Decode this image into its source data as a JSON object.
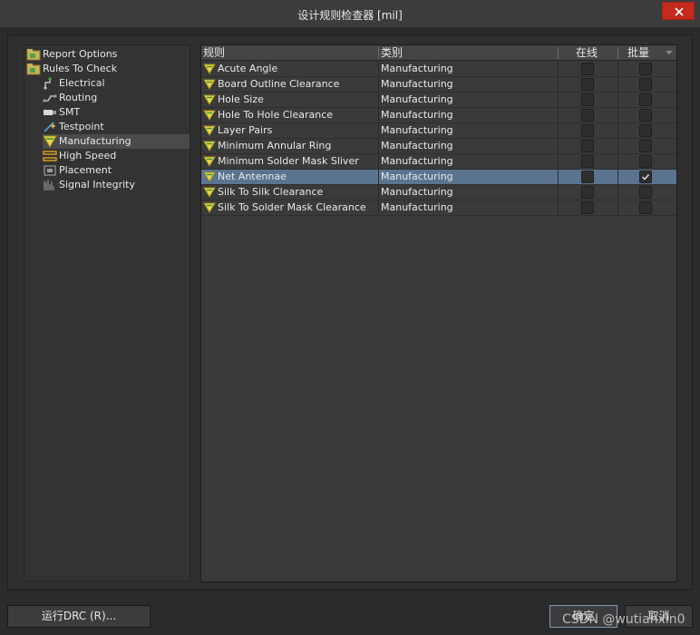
{
  "window": {
    "title": "设计规则检查器 [mil]"
  },
  "tree": {
    "items": [
      {
        "label": "Report Options",
        "icon": "folder-icon"
      },
      {
        "label": "Rules To Check",
        "icon": "folder-icon"
      },
      {
        "label": "Electrical",
        "icon": "electrical-icon"
      },
      {
        "label": "Routing",
        "icon": "routing-icon"
      },
      {
        "label": "SMT",
        "icon": "smt-icon"
      },
      {
        "label": "Testpoint",
        "icon": "testpoint-icon"
      },
      {
        "label": "Manufacturing",
        "icon": "manufacturing-icon"
      },
      {
        "label": "High Speed",
        "icon": "high-speed-icon"
      },
      {
        "label": "Placement",
        "icon": "placement-icon"
      },
      {
        "label": "Signal Integrity",
        "icon": "signal-integrity-icon"
      }
    ],
    "selected": "Manufacturing"
  },
  "grid": {
    "headers": {
      "rule": "规则",
      "category": "类别",
      "online": "在线",
      "batch": "批量"
    },
    "rows": [
      {
        "rule": "Acute Angle",
        "category": "Manufacturing",
        "online": false,
        "batch": false
      },
      {
        "rule": "Board Outline Clearance",
        "category": "Manufacturing",
        "online": false,
        "batch": false
      },
      {
        "rule": "Hole Size",
        "category": "Manufacturing",
        "online": false,
        "batch": false
      },
      {
        "rule": "Hole To Hole Clearance",
        "category": "Manufacturing",
        "online": false,
        "batch": false
      },
      {
        "rule": "Layer Pairs",
        "category": "Manufacturing",
        "online": false,
        "batch": false
      },
      {
        "rule": "Minimum Annular Ring",
        "category": "Manufacturing",
        "online": false,
        "batch": false
      },
      {
        "rule": "Minimum Solder Mask Sliver",
        "category": "Manufacturing",
        "online": false,
        "batch": false
      },
      {
        "rule": "Net Antennae",
        "category": "Manufacturing",
        "online": false,
        "batch": true
      },
      {
        "rule": "Silk To Silk Clearance",
        "category": "Manufacturing",
        "online": false,
        "batch": false
      },
      {
        "rule": "Silk To Solder Mask Clearance",
        "category": "Manufacturing",
        "online": false,
        "batch": false
      }
    ],
    "selected_row": "Net Antennae"
  },
  "buttons": {
    "run_drc": "运行DRC (R)...",
    "ok": "确定",
    "cancel": "取消"
  },
  "watermark": "CSDN @wutianxin0",
  "colors": {
    "selection": "#5a7490",
    "close": "#c42b1c",
    "rule_icon": "#e6d84a"
  }
}
